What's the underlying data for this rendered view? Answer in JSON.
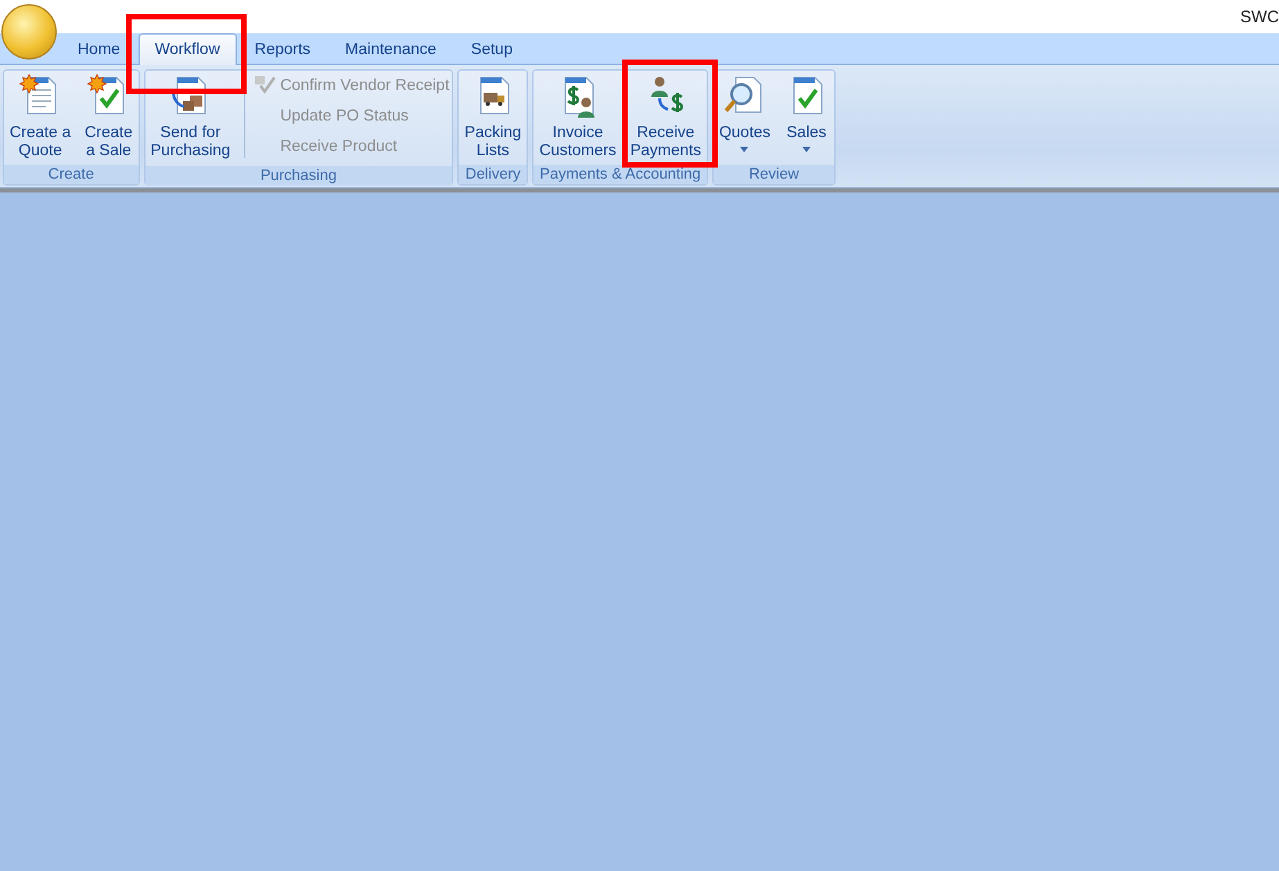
{
  "window": {
    "title": "SWC"
  },
  "tabs": [
    {
      "label": "Home",
      "selected": false,
      "highlighted": false
    },
    {
      "label": "Workflow",
      "selected": true,
      "highlighted": true
    },
    {
      "label": "Reports",
      "selected": false,
      "highlighted": false
    },
    {
      "label": "Maintenance",
      "selected": false,
      "highlighted": false
    },
    {
      "label": "Setup",
      "selected": false,
      "highlighted": false
    }
  ],
  "ribbon": {
    "groups": [
      {
        "label": "Create",
        "items": [
          {
            "kind": "large",
            "lines": [
              "Create a",
              "Quote"
            ],
            "dropdown": false,
            "highlighted": false
          },
          {
            "kind": "large",
            "lines": [
              "Create",
              "a Sale"
            ],
            "dropdown": false,
            "highlighted": false
          }
        ]
      },
      {
        "label": "Purchasing",
        "items": [
          {
            "kind": "large",
            "lines": [
              "Send for",
              "Purchasing"
            ],
            "dropdown": false,
            "highlighted": false
          },
          {
            "kind": "small",
            "label": "Confirm Vendor Receipt",
            "disabled": true,
            "icon": true
          },
          {
            "kind": "small",
            "label": "Update PO Status",
            "disabled": true,
            "icon": false
          },
          {
            "kind": "small",
            "label": "Receive Product",
            "disabled": true,
            "icon": false
          }
        ]
      },
      {
        "label": "Delivery",
        "items": [
          {
            "kind": "large",
            "lines": [
              "Packing",
              "Lists"
            ],
            "dropdown": false,
            "highlighted": false
          }
        ]
      },
      {
        "label": "Payments & Accounting",
        "items": [
          {
            "kind": "large",
            "lines": [
              "Invoice",
              "Customers"
            ],
            "dropdown": false,
            "highlighted": false
          },
          {
            "kind": "large",
            "lines": [
              "Receive",
              "Payments"
            ],
            "dropdown": false,
            "highlighted": true
          }
        ]
      },
      {
        "label": "Review",
        "items": [
          {
            "kind": "large",
            "lines": [
              "Quotes"
            ],
            "dropdown": true,
            "highlighted": false
          },
          {
            "kind": "large",
            "lines": [
              "Sales"
            ],
            "dropdown": true,
            "highlighted": false
          }
        ]
      }
    ]
  }
}
